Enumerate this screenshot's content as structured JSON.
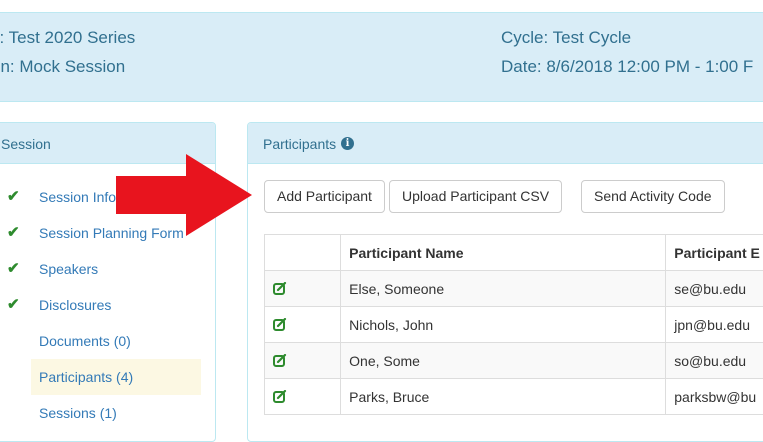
{
  "banner": {
    "series": "s: Test 2020 Series",
    "session": "on: Mock Session",
    "cycle": "Cycle: Test Cycle",
    "date": "Date: 8/6/2018 12:00 PM - 1:00 F"
  },
  "sidebar": {
    "title": "Session",
    "items": [
      {
        "label": "Session Info",
        "checked": true
      },
      {
        "label": "Session Planning Form",
        "checked": true
      },
      {
        "label": "Speakers",
        "checked": true
      },
      {
        "label": "Disclosures",
        "checked": true
      },
      {
        "label": "Documents (0)",
        "checked": false
      },
      {
        "label": "Participants (4)",
        "checked": false,
        "active": true
      },
      {
        "label": "Sessions (1)",
        "checked": false
      }
    ]
  },
  "participants": {
    "title": "Participants",
    "info_icon": "info-circle-icon",
    "buttons": {
      "add": "Add Participant",
      "upload": "Upload Participant CSV",
      "send": "Send Activity Code"
    },
    "columns": [
      "",
      "Participant Name",
      "Participant E"
    ],
    "rows": [
      {
        "name": "Else, Someone",
        "email": "se@bu.edu"
      },
      {
        "name": "Nichols, John",
        "email": "jpn@bu.edu"
      },
      {
        "name": "One, Some",
        "email": "so@bu.edu"
      },
      {
        "name": "Parks, Bruce",
        "email": "parksbw@bu"
      }
    ]
  },
  "colors": {
    "banner_bg": "#d9edf7",
    "banner_text": "#31708f",
    "link": "#337ab7",
    "check": "#2e8b2e",
    "arrow": "#e8141e"
  }
}
